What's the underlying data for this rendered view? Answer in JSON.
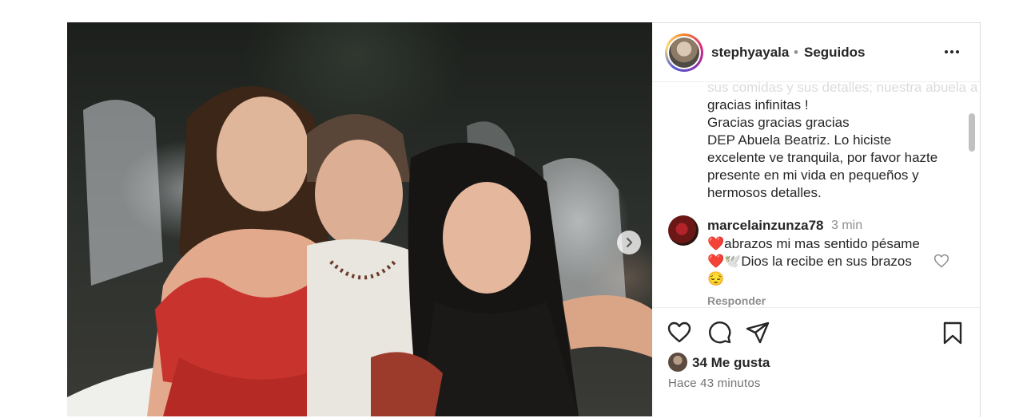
{
  "post": {
    "username": "stephyayala",
    "separator": "•",
    "follow_status": "Seguidos",
    "caption_lines": [
      "sus comidas y sus detalles; nuestra abuela a la que le",
      "gracias infinitas !",
      "Gracias gracias gracias",
      "DEP Abuela Beatriz. Lo hiciste",
      "excelente ve tranquila, por favor hazte",
      "presente en mi vida en pequeños y",
      "hermosos detalles."
    ],
    "likes": "34 Me gusta",
    "time_ago": "Hace 43 minutos"
  },
  "comment": {
    "username": "marcelainzunza78",
    "time": "3 min",
    "lines": [
      "❤️abrazos mi mas sentido pésame",
      "❤️🕊️Dios la recibe en sus brazos",
      "😔"
    ],
    "reply_label": "Responder"
  },
  "icons": {
    "more": "more-options-icon",
    "next": "chevron-right-icon",
    "like": "heart-icon",
    "comment": "comment-icon",
    "share": "share-icon",
    "save": "bookmark-icon"
  },
  "colors": {
    "text": "#262626",
    "muted": "#8e8e8e",
    "border": "#dbdbdb"
  }
}
